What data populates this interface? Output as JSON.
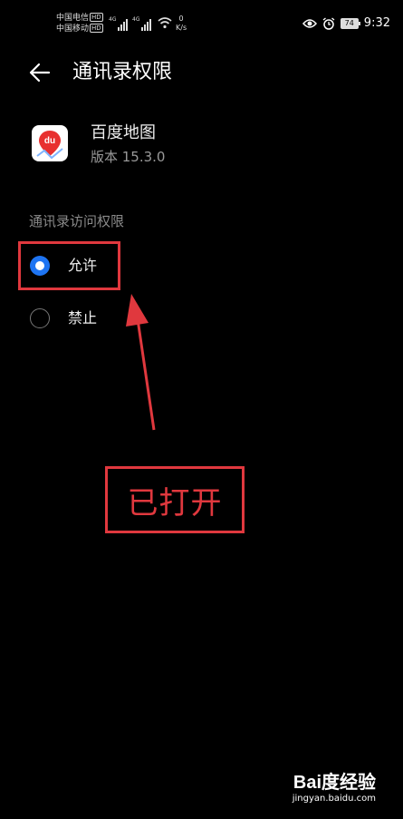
{
  "status_bar": {
    "carrier1": "中国电信",
    "carrier2": "中国移动",
    "hd": "HD",
    "net1": "4G",
    "net2": "4G",
    "speed_value": "0",
    "speed_unit": "K/s",
    "battery": "74",
    "time": "9:32"
  },
  "header": {
    "title": "通讯录权限"
  },
  "app": {
    "name": "百度地图",
    "version": "版本 15.3.0",
    "icon_text": "du"
  },
  "permission": {
    "section_label": "通讯录访问权限",
    "options": [
      {
        "label": "允许",
        "selected": true
      },
      {
        "label": "禁止",
        "selected": false
      }
    ]
  },
  "annotation": {
    "callout": "已打开",
    "color": "#e0383e"
  },
  "watermark": {
    "logo": "Bai度经验",
    "url": "jingyan.baidu.com"
  },
  "colors": {
    "accent": "#1e74f2",
    "background": "#000000"
  }
}
